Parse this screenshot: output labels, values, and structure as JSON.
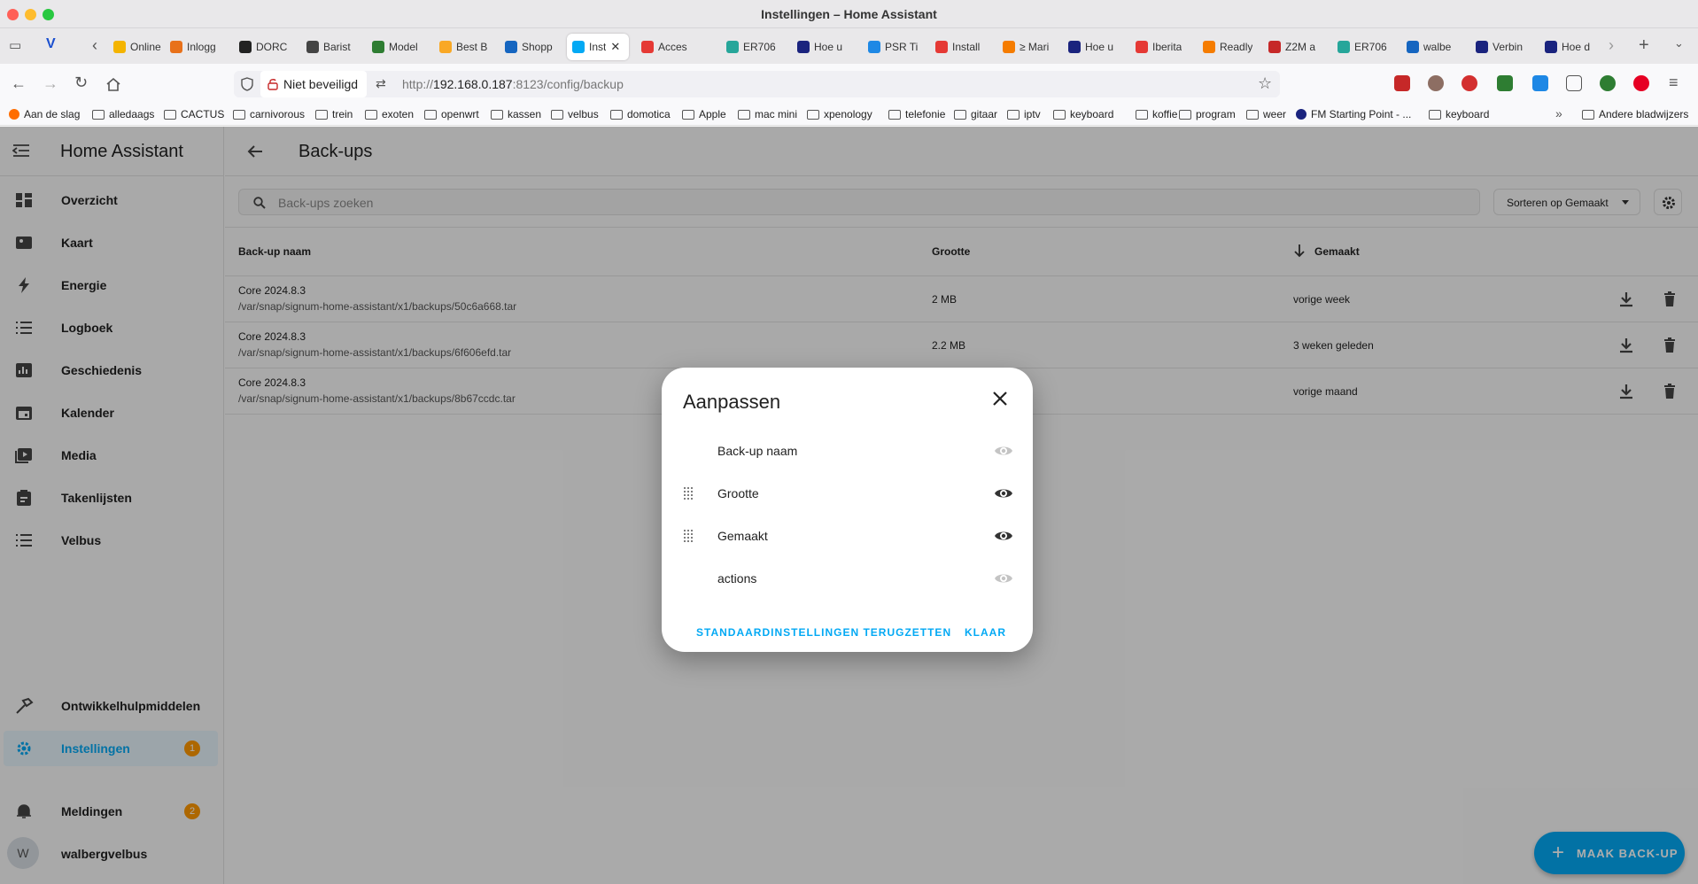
{
  "window": {
    "title": "Instellingen – Home Assistant"
  },
  "tabs": [
    {
      "label": "Online",
      "color": "#f4b400"
    },
    {
      "label": "Inlogg",
      "color": "#e8711a"
    },
    {
      "label": "DORC",
      "color": "#222222"
    },
    {
      "label": "Barist",
      "color": "#444444"
    },
    {
      "label": "Model",
      "color": "#2e7d32"
    },
    {
      "label": "Best B",
      "color": "#f9a825"
    },
    {
      "label": "Shopp",
      "color": "#1565c0"
    },
    {
      "label": "Inst",
      "color": "#03a9f4"
    },
    {
      "label": "Acces",
      "color": "#e53935"
    },
    {
      "label": "ER706",
      "color": "#26a69a"
    },
    {
      "label": "Hoe u",
      "color": "#1a237e"
    },
    {
      "label": "PSR Ti",
      "color": "#1e88e5"
    },
    {
      "label": "Install",
      "color": "#e53935"
    },
    {
      "label": "≥ Mari",
      "color": "#f57c00"
    },
    {
      "label": "Hoe u",
      "color": "#1a237e"
    },
    {
      "label": "Iberita",
      "color": "#e53935"
    },
    {
      "label": "Readly",
      "color": "#f57c00"
    },
    {
      "label": "Z2M a",
      "color": "#c62828"
    },
    {
      "label": "ER706",
      "color": "#26a69a"
    },
    {
      "label": "walbe",
      "color": "#1565c0"
    },
    {
      "label": "Verbin",
      "color": "#1a237e"
    },
    {
      "label": "Hoe d",
      "color": "#1a237e"
    }
  ],
  "address": {
    "security_label": "Niet beveiligd",
    "url_prefix": "http://",
    "url_host": "192.168.0.187",
    "url_rest": ":8123/config/backup"
  },
  "bookmarks": [
    "Aan de slag",
    "alledaags",
    "CACTUS",
    "carnivorous",
    "trein",
    "exoten",
    "openwrt",
    "kassen",
    "velbus",
    "domotica",
    "Apple",
    "mac mini",
    "xpenology",
    "telefonie",
    "gitaar",
    "iptv",
    "keyboard",
    "koffie",
    "program",
    "weer",
    "FM Starting Point - ...",
    "keyboard"
  ],
  "bookmarks_other": "Andere bladwijzers",
  "sidebar": {
    "title": "Home Assistant",
    "items": [
      {
        "label": "Overzicht",
        "icon": "dashboard-icon"
      },
      {
        "label": "Kaart",
        "icon": "map-icon"
      },
      {
        "label": "Energie",
        "icon": "lightning-icon"
      },
      {
        "label": "Logboek",
        "icon": "list-icon"
      },
      {
        "label": "Geschiedenis",
        "icon": "chart-icon"
      },
      {
        "label": "Kalender",
        "icon": "calendar-icon"
      },
      {
        "label": "Media",
        "icon": "media-icon"
      },
      {
        "label": "Takenlijsten",
        "icon": "clipboard-icon"
      },
      {
        "label": "Velbus",
        "icon": "list-icon"
      }
    ],
    "developer": "Ontwikkelhulpmiddelen",
    "settings": {
      "label": "Instellingen",
      "badge": "1"
    },
    "notifications": {
      "label": "Meldingen",
      "badge": "2"
    },
    "user": {
      "initial": "W",
      "name": "walbergvelbus"
    }
  },
  "page": {
    "title": "Back-ups",
    "search_placeholder": "Back-ups zoeken",
    "sort_label": "Sorteren op Gemaakt",
    "columns": {
      "name": "Back-up naam",
      "size": "Grootte",
      "created": "Gemaakt"
    },
    "rows": [
      {
        "name": "Core 2024.8.3",
        "path": "/var/snap/signum-home-assistant/x1/backups/50c6a668.tar",
        "size": "2 MB",
        "created": "vorige week"
      },
      {
        "name": "Core 2024.8.3",
        "path": "/var/snap/signum-home-assistant/x1/backups/6f606efd.tar",
        "size": "2.2 MB",
        "created": "3 weken geleden"
      },
      {
        "name": "Core 2024.8.3",
        "path": "/var/snap/signum-home-assistant/x1/backups/8b67ccdc.tar",
        "size": "",
        "created": "vorige maand"
      }
    ],
    "fab_label": "MAAK BACK-UP"
  },
  "dialog": {
    "title": "Aanpassen",
    "columns": [
      {
        "label": "Back-up naam",
        "draggable": false,
        "visible": false
      },
      {
        "label": "Grootte",
        "draggable": true,
        "visible": true
      },
      {
        "label": "Gemaakt",
        "draggable": true,
        "visible": true
      },
      {
        "label": "actions",
        "draggable": false,
        "visible": false
      }
    ],
    "reset_label": "STANDAARDINSTELLINGEN TERUGZETTEN",
    "done_label": "KLAAR"
  },
  "colors": {
    "accent": "#03a9f4",
    "badge": "#ff9800"
  }
}
